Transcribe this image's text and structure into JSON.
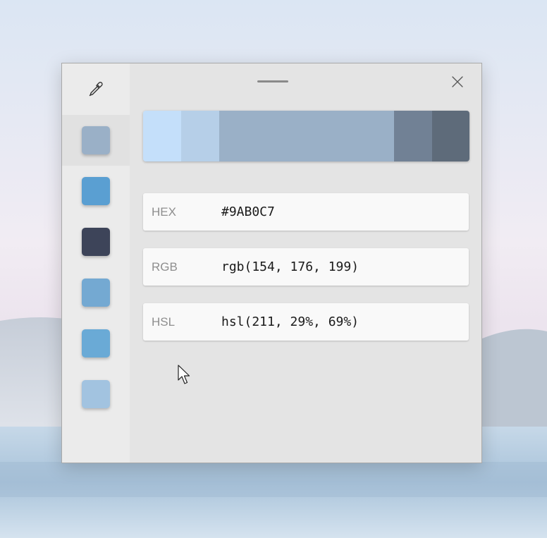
{
  "colors": {
    "selected_hex": "#9AB0C7",
    "history": [
      "#9ab0c7",
      "#5a9fd2",
      "#3d4459",
      "#74a9d2",
      "#6aaad6",
      "#a2c3e0"
    ],
    "shades": [
      "#c4dffa",
      "#b6cfe8",
      "#9ab0c7",
      "#718195",
      "#5e6b7a"
    ]
  },
  "toolbar": {
    "picker_icon": "eyedropper-icon",
    "close_icon": "close-icon"
  },
  "formats": [
    {
      "label": "HEX",
      "value": "#9AB0C7"
    },
    {
      "label": "RGB",
      "value": "rgb(154, 176, 199)"
    },
    {
      "label": "HSL",
      "value": "hsl(211, 29%, 69%)"
    }
  ]
}
